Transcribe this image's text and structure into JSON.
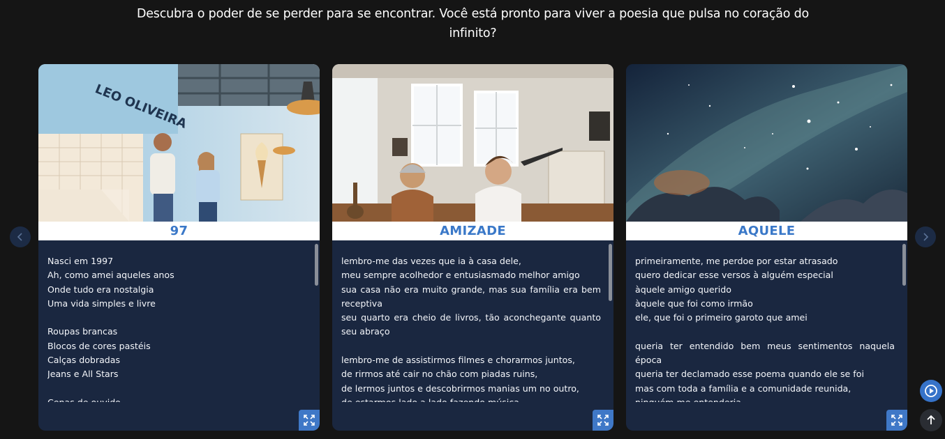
{
  "intro": "Descubra o poder de se perder para se encontrar. Você está pronto para viver a poesia que pulsa no coração do infinito?",
  "colors": {
    "background": "#151515",
    "card_body": "#1a2740",
    "title_text": "#3a78c8",
    "accent_button": "#3f78c7"
  },
  "carousel": {
    "prev_icon": "chevron-left-icon",
    "next_icon": "chevron-right-icon"
  },
  "cards": [
    {
      "title": "97",
      "image_sign": "LEO OLIVEIRA",
      "lines": [
        "Nasci em 1997",
        "Ah, como amei aqueles anos",
        "Onde tudo era nostalgia",
        "Uma vida simples e livre",
        "",
        "Roupas brancas",
        "Blocos de cores pastéis",
        "Calças dobradas",
        "Jeans e All Stars",
        "",
        "Cenas de ouvido"
      ]
    },
    {
      "title": "AMIZADE",
      "lines": [
        "lembro-me das vezes que ia à casa dele,",
        "meu sempre acolhedor e entusiasmado melhor amigo",
        "sua casa não era muito grande, mas sua família era bem receptiva",
        "seu quarto era cheio de livros, tão aconchegante quanto seu abraço",
        "",
        "lembro-me de assistirmos filmes e chorarmos juntos,",
        "de rirmos até cair no chão com piadas ruins,",
        "de lermos juntos e descobrirmos manias um no outro,",
        "de estarmos lado a lado fazendo música"
      ]
    },
    {
      "title": "AQUELE",
      "lines": [
        "primeiramente, me perdoe por estar atrasado",
        "quero dedicar esse versos à alguém especial",
        "àquele amigo querido",
        "àquele que foi como irmão",
        "ele, que foi o primeiro garoto que amei",
        "",
        "queria ter entendido bem meus sentimentos naquela época",
        "queria ter declamado esse poema quando ele se foi",
        "mas com toda a família e a comunidade reunida,",
        "ninguém me entenderia"
      ]
    }
  ]
}
